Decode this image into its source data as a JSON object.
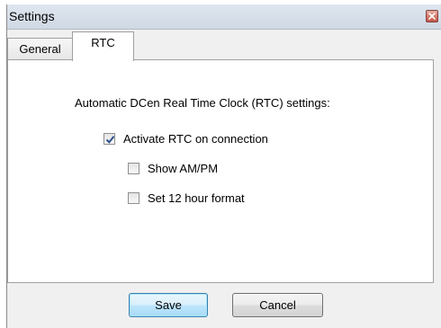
{
  "window": {
    "title": "Settings"
  },
  "tabs": [
    {
      "label": "General",
      "selected": false
    },
    {
      "label": "RTC",
      "selected": true
    }
  ],
  "rtc_panel": {
    "heading": "Automatic DCen Real Time Clock (RTC) settings:",
    "options": [
      {
        "label": "Activate RTC on connection",
        "checked": true
      },
      {
        "label": "Show AM/PM",
        "checked": false
      },
      {
        "label": "Set 12 hour format",
        "checked": false
      }
    ]
  },
  "buttons": {
    "save_label": "Save",
    "cancel_label": "Cancel"
  },
  "colors": {
    "title_bar": "#dfe6ef",
    "dialog_background": "#f0f0f0",
    "panel_background": "#ffffff",
    "close_button": "#c5513e",
    "default_button_border": "#3c7fb1"
  },
  "icons": {
    "close": "close-icon",
    "check": "checkmark-icon"
  }
}
